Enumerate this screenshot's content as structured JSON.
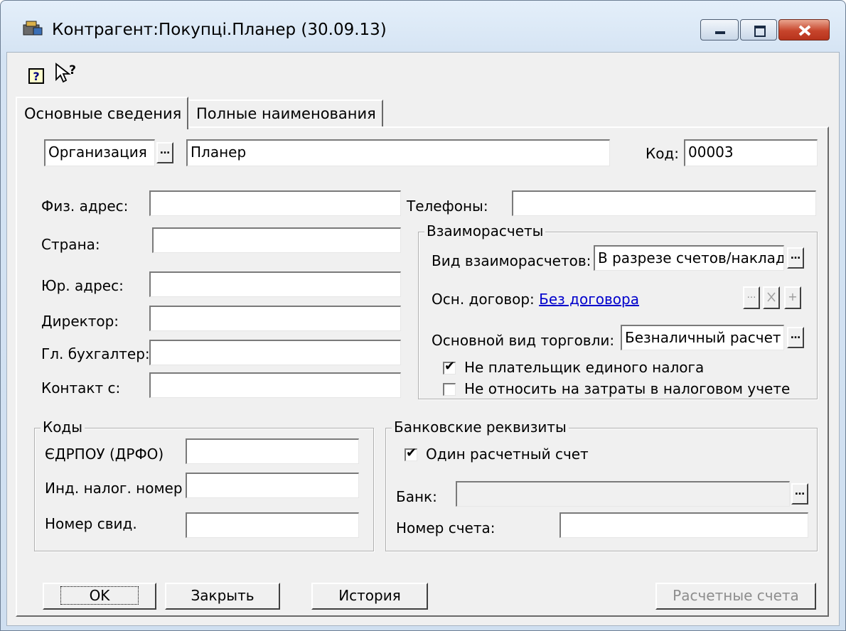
{
  "window": {
    "title": "Контрагент:Покупці.Планер (30.09.13)",
    "icon": "counterparty-app-icon",
    "caption_buttons": [
      "minimize",
      "maximize",
      "close"
    ]
  },
  "toolbar": {
    "icons": [
      "help-book-icon",
      "whats-this-pointer-icon"
    ]
  },
  "tabs": [
    {
      "label": "Основные сведения",
      "active": true
    },
    {
      "label": "Полные наименования",
      "active": false
    }
  ],
  "header_fields": {
    "type_select": "Организация",
    "name_value": "Планер",
    "code_label": "Код:",
    "code_value": "00003"
  },
  "address": {
    "phys_address_label": "Физ. адрес:",
    "phys_address_value": "",
    "country_label": "Страна:",
    "country_value": "",
    "legal_address_label": "Юр. адрес:",
    "legal_address_value": "",
    "director_label": "Директор:",
    "director_value": "",
    "accountant_label": "Гл. бухгалтер:",
    "accountant_value": "",
    "contact_label": "Контакт с:",
    "contact_value": "",
    "phones_label": "Телефоны:",
    "phones_value": ""
  },
  "settlements": {
    "title": "Взаиморасчеты",
    "type_label": "Вид взаиморасчетов:",
    "type_value": "В разрезе счетов/наклад",
    "contract_label": "Осн. договор:",
    "contract_link": "Без договора",
    "trade_label": "Основной вид торговли:",
    "trade_value": "Безналичный расчет",
    "not_single_tax_label": "Не плательщик единого налога",
    "not_single_tax_checked": true,
    "no_cost_label": "Не относить на затраты в налоговом учете",
    "no_cost_checked": false
  },
  "codes": {
    "title": "Коды",
    "edrpou_label": "ЄДРПОУ (ДРФО)",
    "edrpou_value": "",
    "tax_number_label": "Инд. налог. номер",
    "tax_number_value": "",
    "cert_number_label": "Номер свид.",
    "cert_number_value": ""
  },
  "bank": {
    "title": "Банковские реквизиты",
    "single_account_label": "Один расчетный счет",
    "single_account_checked": true,
    "bank_label": "Банк:",
    "bank_value": "",
    "account_label": "Номер счета:",
    "account_value": ""
  },
  "buttons": {
    "ok": "OK",
    "close": "Закрыть",
    "history": "История",
    "accounts": "Расчетные счета"
  },
  "colors": {
    "link": "#0000cc",
    "face": "#f0f0f0",
    "title_bar": "#d4e3f3",
    "close_button": "#c7452c"
  }
}
